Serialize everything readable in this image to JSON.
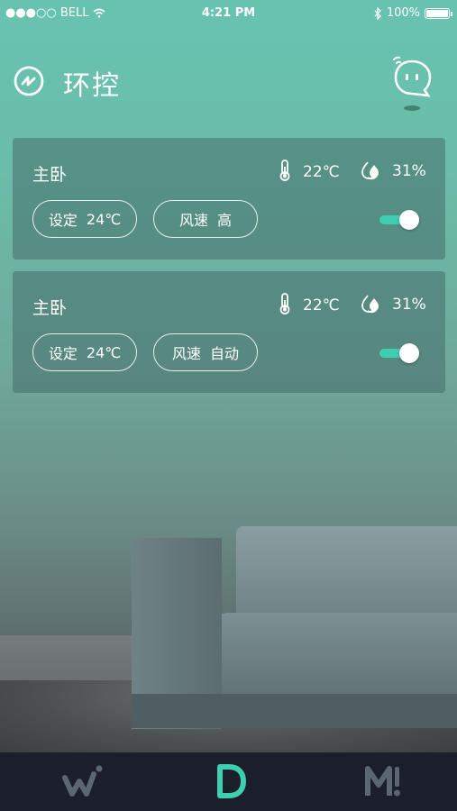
{
  "status_bar": {
    "carrier": "●●●○○ BELL",
    "time": "4:21 PM",
    "battery": "100%"
  },
  "header": {
    "title": "环控"
  },
  "cards": [
    {
      "room": "主卧",
      "temperature": "22℃",
      "humidity": "31%",
      "set_label": "设定",
      "set_value": "24℃",
      "fan_label": "风速",
      "fan_value": "高",
      "power_on": true
    },
    {
      "room": "主卧",
      "temperature": "22℃",
      "humidity": "31%",
      "set_label": "设定",
      "set_value": "24℃",
      "fan_label": "风速",
      "fan_value": "自动",
      "power_on": true
    }
  ],
  "tabs": [
    {
      "icon": "w-logo-icon",
      "active": false
    },
    {
      "icon": "d-logo-icon",
      "active": true
    },
    {
      "icon": "m-logo-icon",
      "active": false
    }
  ],
  "colors": {
    "accent": "#3ecfb0",
    "tabbar": "#1a1f2b",
    "inactive_tab": "#5c6670"
  }
}
